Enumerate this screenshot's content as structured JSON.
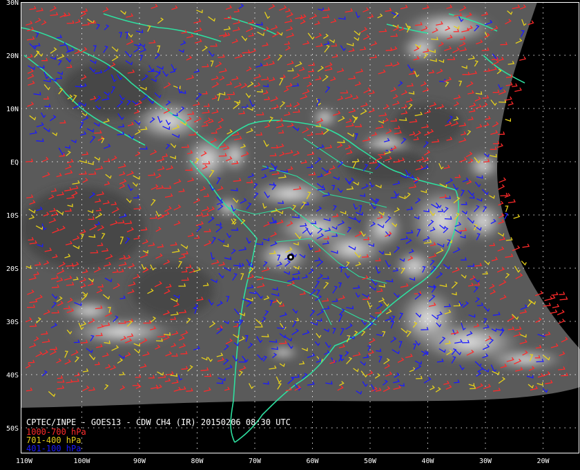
{
  "title": "CPTEC/INPE - GOES13 - CDW CH4 (IR) 20150206 08:30 UTC",
  "legend": [
    {
      "label": "1000-700 hPa",
      "color": "#ff2a2a"
    },
    {
      "label": "701-400 hPa",
      "color": "#e8d21a"
    },
    {
      "label": "401-100 hPa",
      "color": "#1a1aff"
    }
  ],
  "colors": {
    "coastline": "#2ee0a0",
    "grid": "#ffffff",
    "background": "#000000",
    "cloud_base": "#5c5c5c"
  },
  "latitude_labels": [
    "30N",
    "20N",
    "10N",
    "EQ",
    "10S",
    "20S",
    "30S",
    "40S",
    "50S"
  ],
  "longitude_labels": [
    "110W",
    "100W",
    "90W",
    "80W",
    "70W",
    "60W",
    "50W",
    "40W",
    "30W",
    "20W"
  ],
  "wind_layers": [
    "1000-700 hPa",
    "701-400 hPa",
    "401-100 hPa"
  ]
}
